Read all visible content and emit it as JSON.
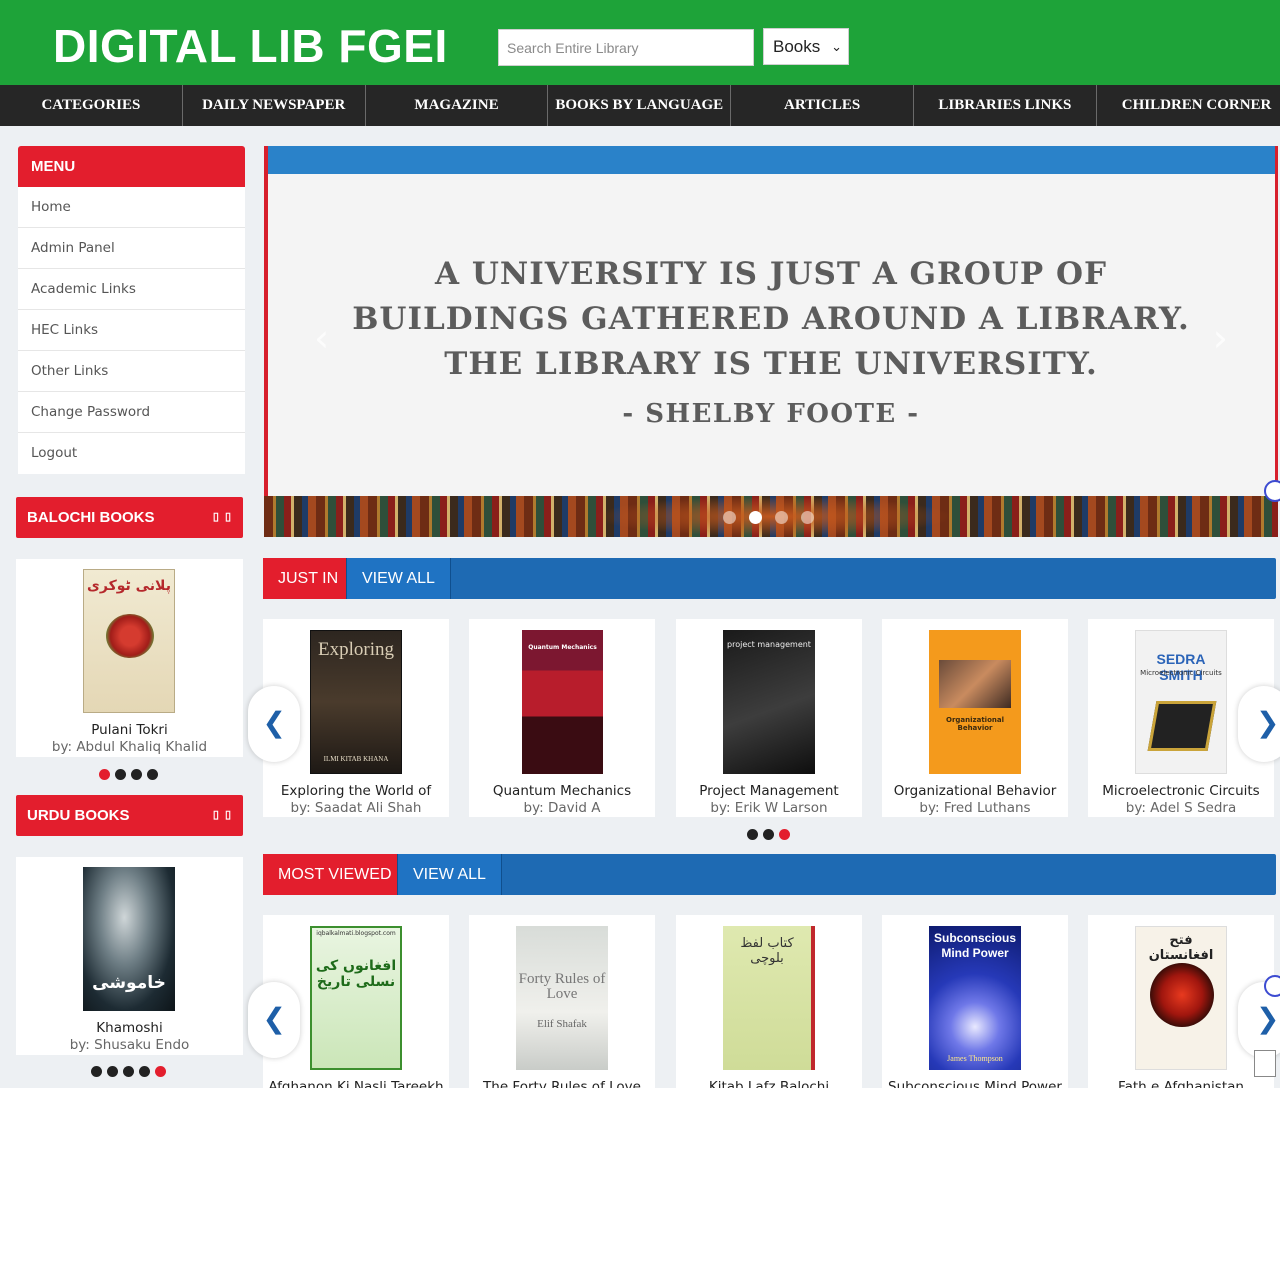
{
  "header": {
    "brand": "DIGITAL LIB FGEI",
    "search_placeholder": "Search Entire Library",
    "search_scope": "Books"
  },
  "nav": [
    "CATEGORIES",
    "DAILY NEWSPAPER",
    "MAGAZINE",
    "BOOKS BY LANGUAGE",
    "ARTICLES",
    "LIBRARIES LINKS",
    "CHILDREN CORNER"
  ],
  "menu": {
    "title": "MENU",
    "items": [
      "Home",
      "Admin Panel",
      "Academic Links",
      "HEC Links",
      "Other Links",
      "Change Password",
      "Logout"
    ]
  },
  "balochi_books": {
    "title": "BALOCHI BOOKS",
    "controls": "▯▯",
    "book": {
      "title": "Pulani Tokri",
      "author": "by: Abdul Khaliq Khalid",
      "cover_text": "پلانی ٹوکری"
    }
  },
  "urdu_books": {
    "title": "URDU BOOKS",
    "controls": "▯▯",
    "book": {
      "title": "Khamoshi",
      "author": "by: Shusaku Endo",
      "cover_text": "خاموشی"
    }
  },
  "banner": {
    "quote_line1": "A UNIVERSITY IS JUST A GROUP OF",
    "quote_line2": "BUILDINGS GATHERED AROUND A LIBRARY.",
    "quote_line3": "THE LIBRARY IS THE UNIVERSITY.",
    "author": "- SHELBY FOOTE -",
    "active_slide": 2,
    "slide_count": 4
  },
  "just_in": {
    "tab_label": "JUST IN",
    "view_all": "VIEW ALL",
    "books": [
      {
        "title": "Exploring the World of",
        "author": "by: Saadat Ali Shah",
        "cover_text": "Exploring",
        "cover_sub": "ILMI KITAB KHANA"
      },
      {
        "title": "Quantum Mechanics",
        "author": "by: David A",
        "cover_text": "Quantum Mechanics"
      },
      {
        "title": "Project Management",
        "author": "by: Erik W Larson",
        "cover_text": "project management"
      },
      {
        "title": "Organizational Behavior",
        "author": "by: Fred Luthans",
        "cover_text": "Organizational Behavior"
      },
      {
        "title": "Microelectronic Circuits",
        "author": "by: Adel S Sedra",
        "cover_text": "SEDRA SMITH",
        "cover_sub": "Microelectronic Circuits"
      }
    ]
  },
  "most_viewed": {
    "tab_label": "MOST VIEWED",
    "view_all": "VIEW ALL",
    "books": [
      {
        "title": "Afghanon Ki Nasli Tareekh",
        "cover_text": "افغانوں کی نسلی تاریخ",
        "cover_sub": "iqbalkalmati.blogspot.com"
      },
      {
        "title": "The Forty Rules of Love",
        "cover_text": "Forty Rules of Love",
        "cover_sub": "Elif Shafak"
      },
      {
        "title": "Kitab Lafz Balochi",
        "cover_text": "کتاب لفظ بلوچی"
      },
      {
        "title": "Subconscious Mind Power",
        "cover_text": "Subconscious Mind Power",
        "cover_sub": "James Thompson"
      },
      {
        "title": "Fath e Afghanistan",
        "cover_text": "فتح افغانستان"
      }
    ]
  },
  "colors": {
    "header_green": "#1ea339",
    "nav_dark": "#262626",
    "accent_red": "#e31e2d",
    "accent_blue": "#1e6ab3"
  }
}
